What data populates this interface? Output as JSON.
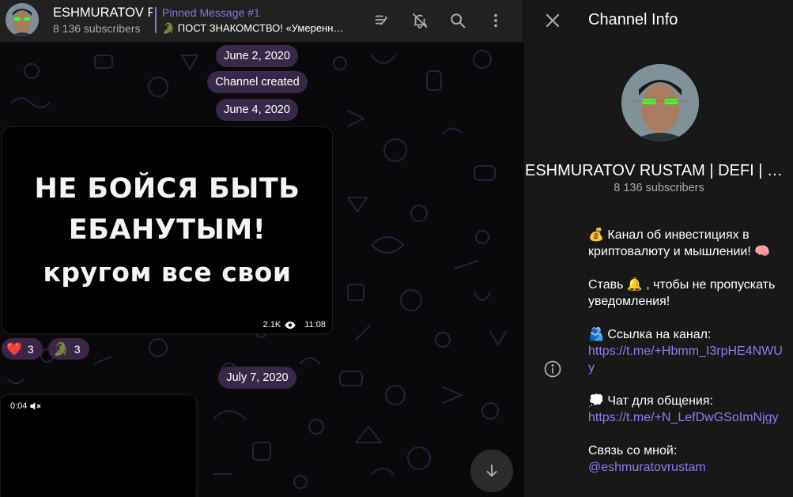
{
  "header": {
    "channel_title": "ESHMURATOV RUSTAM | DEFI | CRYPTO",
    "subscribers": "8 136 subscribers",
    "pinned_label": "Pinned Message #1",
    "pinned_text": "🐊 ПОСТ ЗНАКОМСТВО! «Умеренность — это ловушка»",
    "icons": [
      "pinned-list-icon",
      "mute-icon",
      "search-icon",
      "more-icon"
    ]
  },
  "chat": {
    "date_1": "June 2, 2020",
    "service_created": "Channel created",
    "date_2": "June 4, 2020",
    "photo_post": {
      "line1": "НЕ БОЙСЯ БЫТЬ",
      "line2": "ЕБАНУТЫМ!",
      "line3": "кругом все свои",
      "views": "2.1K",
      "time": "11:08"
    },
    "reactions": [
      {
        "emoji": "❤️",
        "count": "3"
      },
      {
        "emoji": "🐊",
        "count": "3"
      }
    ],
    "date_3": "July 7, 2020",
    "video_duration": "0:04"
  },
  "info_panel": {
    "title": "Channel Info",
    "name": "ESHMURATOV RUSTAM | DEFI | CRYPTO",
    "subscribers": "8 136 subscribers",
    "description": {
      "line1": "💰  Канал об инвестициях в криптовалюту и мышлении! 🧠",
      "line2": "Ставь 🔔 , чтобы не пропускать уведомления!",
      "line3_label": "🫂 Ссылка на канал:",
      "line3_link": "https://t.me/+Hbmm_I3rpHE4NWUy",
      "line4_label": "💭  Чат для общения:",
      "line4_link": "https://t.me/+N_LefDwGSoImNjgy",
      "line5_label": "Связь со мной:",
      "line5_link": "@eshmuratovrustam"
    }
  },
  "colors": {
    "accent": "#8774e1",
    "pill_bg": "#3a2848",
    "panel_bg": "#181818",
    "header_bg": "#212121"
  }
}
